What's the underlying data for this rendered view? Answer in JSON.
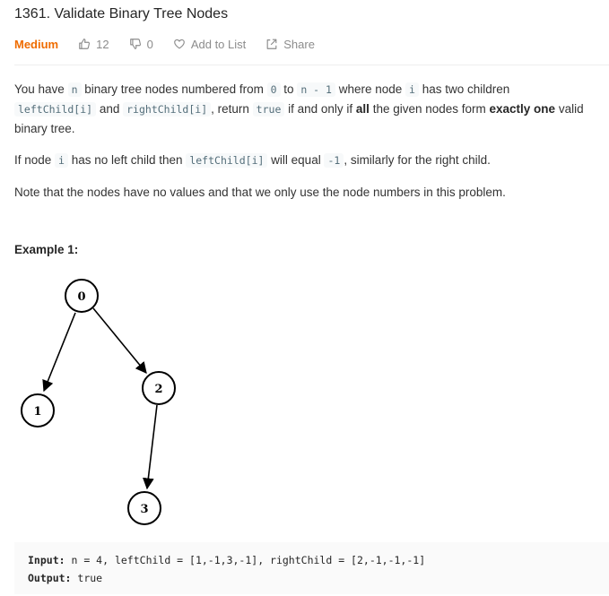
{
  "problem": {
    "title": "1361. Validate Binary Tree Nodes",
    "difficulty": "Medium",
    "likes": "12",
    "dislikes": "0",
    "add_to_list": "Add to List",
    "share": "Share"
  },
  "description": {
    "p1": {
      "t1": "You have ",
      "c1": "n",
      "t2": " binary tree nodes numbered from ",
      "c2": "0",
      "t3": " to ",
      "c3": "n - 1",
      "t4": " where node ",
      "c4": "i",
      "t5": " has two children ",
      "c5": "leftChild[i]",
      "t6": " and ",
      "c6": "rightChild[i]",
      "t7": ", return ",
      "c7": "true",
      "t8": " if and only if ",
      "b1": "all",
      "t9": " the given nodes form ",
      "b2": "exactly one",
      "t10": " valid binary tree."
    },
    "p2": {
      "t1": "If node ",
      "c1": "i",
      "t2": " has no left child then ",
      "c2": "leftChild[i]",
      "t3": " will equal ",
      "c3": "-1",
      "t4": ", similarly for the right child."
    },
    "p3": "Note that the nodes have no values and that we only use the node numbers in this problem."
  },
  "example1": {
    "title": "Example 1:",
    "tree_nodes": [
      "0",
      "1",
      "2",
      "3"
    ],
    "input_label": "Input:",
    "input_value": "n = 4, leftChild = [1,-1,3,-1], rightChild = [2,-1,-1,-1]",
    "output_label": "Output:",
    "output_value": "true"
  },
  "icons": {
    "like": "thumbs-up-icon",
    "dislike": "thumbs-down-icon",
    "add": "heart-icon",
    "share": "share-icon"
  },
  "colors": {
    "difficulty": "#ef6c00",
    "code_bg": "#f7f9fa",
    "code_text": "#546e7a"
  }
}
